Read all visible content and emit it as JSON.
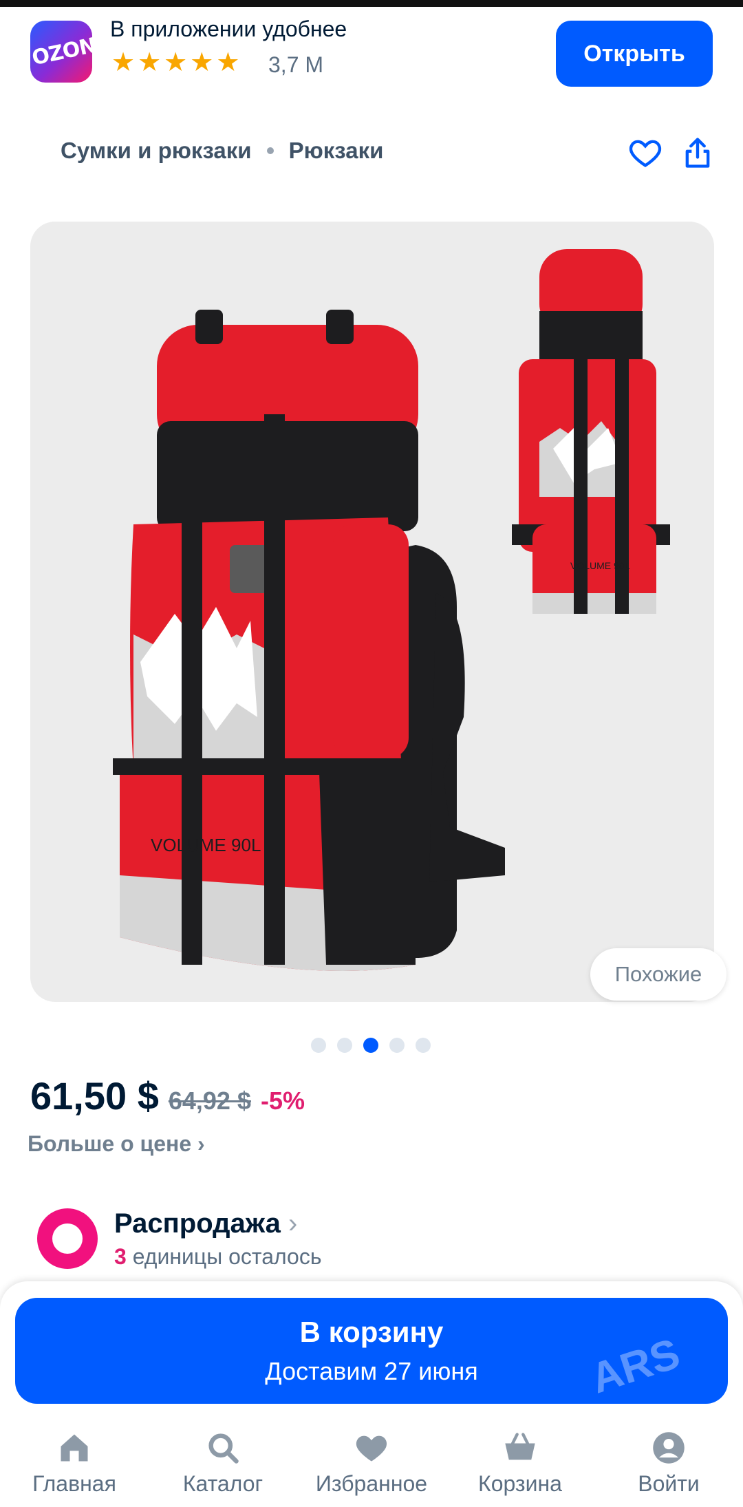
{
  "app_banner": {
    "logo_text": "OZON",
    "title": "В приложении удобнее",
    "stars": 5,
    "rating_count": "3,7 М",
    "open_button": "Открыть"
  },
  "breadcrumb": {
    "items": [
      "Сумки и рюкзаки",
      "Рюкзаки"
    ]
  },
  "product": {
    "image_labels": [
      "VOLUME 90L",
      "VOLUME 90L"
    ],
    "similar_button": "Похожие",
    "gallery_dots": 5,
    "gallery_active_index": 2,
    "price": "61,50 $",
    "old_price": "64,92 $",
    "discount": "-5%",
    "more_price": "Больше о цене"
  },
  "sale": {
    "title": "Распродажа",
    "left_count": "3",
    "left_text": "единицы осталось"
  },
  "cart": {
    "button_label": "В корзину",
    "delivery": "Доставим 27 июня",
    "watermark": "ARS"
  },
  "nav": {
    "items": [
      "Главная",
      "Каталог",
      "Избранное",
      "Корзина",
      "Войти"
    ]
  },
  "colors": {
    "accent": "#005bff",
    "sale_pink": "#e01e6f",
    "backpack_red": "#e41e2b",
    "backpack_black": "#1d1d1f"
  }
}
